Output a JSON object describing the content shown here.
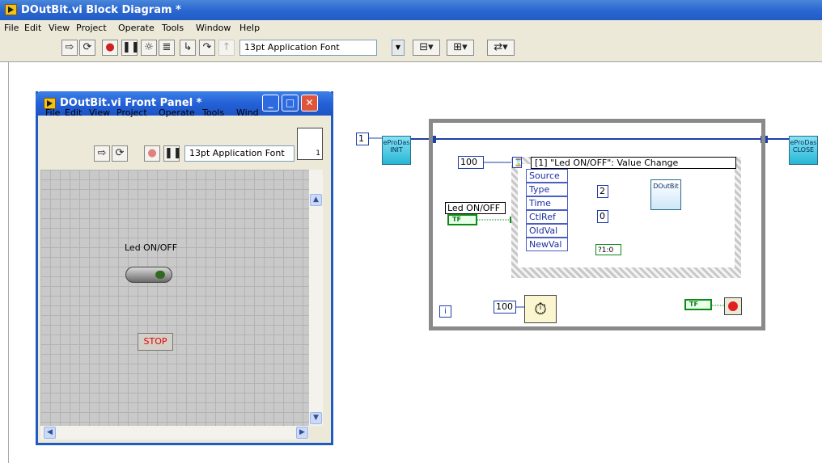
{
  "window": {
    "title": "DOutBit.vi Block Diagram *"
  },
  "menu": [
    "File",
    "Edit",
    "View",
    "Project",
    "Operate",
    "Tools",
    "Window",
    "Help"
  ],
  "toolbar": {
    "font": "13pt Application Font"
  },
  "front_panel": {
    "title": "DOutBit.vi Front Panel *",
    "menu": [
      "File",
      "Edit",
      "View",
      "Project",
      "Operate",
      "Tools",
      "Wind"
    ],
    "font": "13pt Application Font",
    "connector_label": "1",
    "led_label": "Led ON/OFF",
    "stop_label": "STOP"
  },
  "diagram": {
    "const_init": "1",
    "vi_init": "eProDas INIT",
    "vi_close": "eProDas CLOSE",
    "timeout_const": "100",
    "event_case": "[1] \"Led ON/OFF\": Value Change",
    "event_items": [
      "Source",
      "Type",
      "Time",
      "CtlRef",
      "OldVal",
      "NewVal"
    ],
    "control_label": "Led ON/OFF",
    "bool_text": "TF",
    "port_const": "2",
    "bit_const": "0",
    "bool_conv": "?1:0",
    "doutbit_vi": "DOutBit",
    "wait_const": "100",
    "iteration": "i"
  }
}
